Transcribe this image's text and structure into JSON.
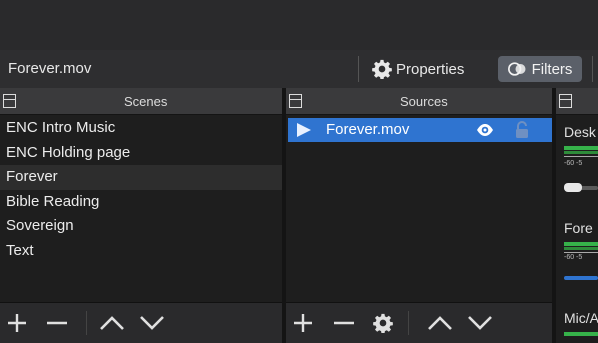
{
  "info_bar": {
    "source_name": "Forever.mov",
    "properties_label": "Properties",
    "filters_label": "Filters"
  },
  "scenes": {
    "title": "Scenes",
    "items": [
      "ENC Intro Music",
      "ENC Holding page",
      "Forever",
      "Bible Reading",
      "Sovereign",
      "Text"
    ],
    "selected_index": 2
  },
  "sources": {
    "title": "Sources",
    "items": [
      {
        "label": "Forever.mov",
        "visible": true,
        "locked": false
      }
    ]
  },
  "mixer": {
    "channels": [
      {
        "label": "Desk",
        "tick_labels": "-60  -5"
      },
      {
        "label": "Fore",
        "tick_labels": "-60  -5"
      },
      {
        "label": "Mic/A"
      }
    ]
  },
  "colors": {
    "selection_blue": "#2f74d0",
    "meter_green": "#36b24a"
  }
}
